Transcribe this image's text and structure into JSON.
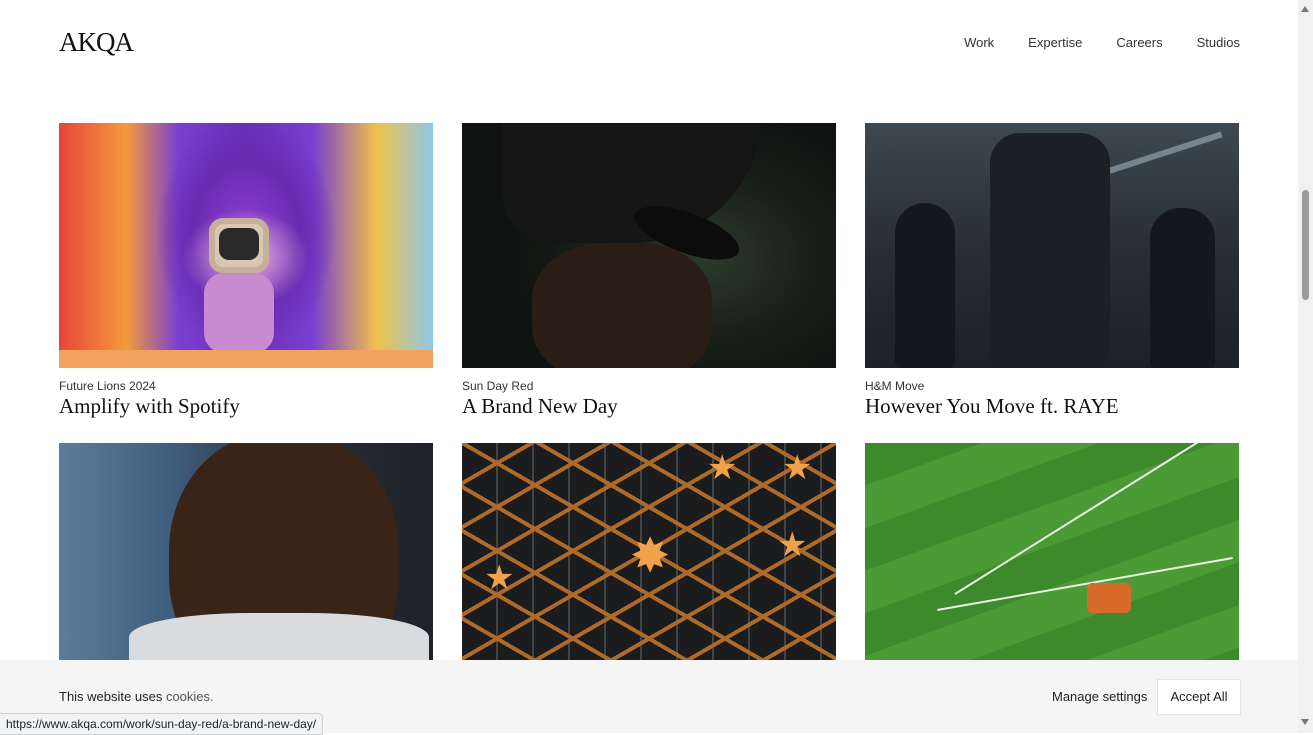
{
  "header": {
    "logo": "AKQA",
    "nav": [
      "Work",
      "Expertise",
      "Careers",
      "Studios"
    ]
  },
  "cards": [
    {
      "client": "Future Lions 2024",
      "title": "Amplify with Spotify"
    },
    {
      "client": "Sun Day Red",
      "title": "A Brand New Day"
    },
    {
      "client": "H&M Move",
      "title": "However You Move ft. RAYE"
    },
    {
      "client": "",
      "title": ""
    },
    {
      "client": "",
      "title": ""
    },
    {
      "client": "",
      "title": ""
    }
  ],
  "cookie": {
    "text": "This website uses",
    "link": "cookies.",
    "manage": "Manage settings",
    "accept": "Accept All"
  },
  "status_url": "https://www.akqa.com/work/sun-day-red/a-brand-new-day/"
}
